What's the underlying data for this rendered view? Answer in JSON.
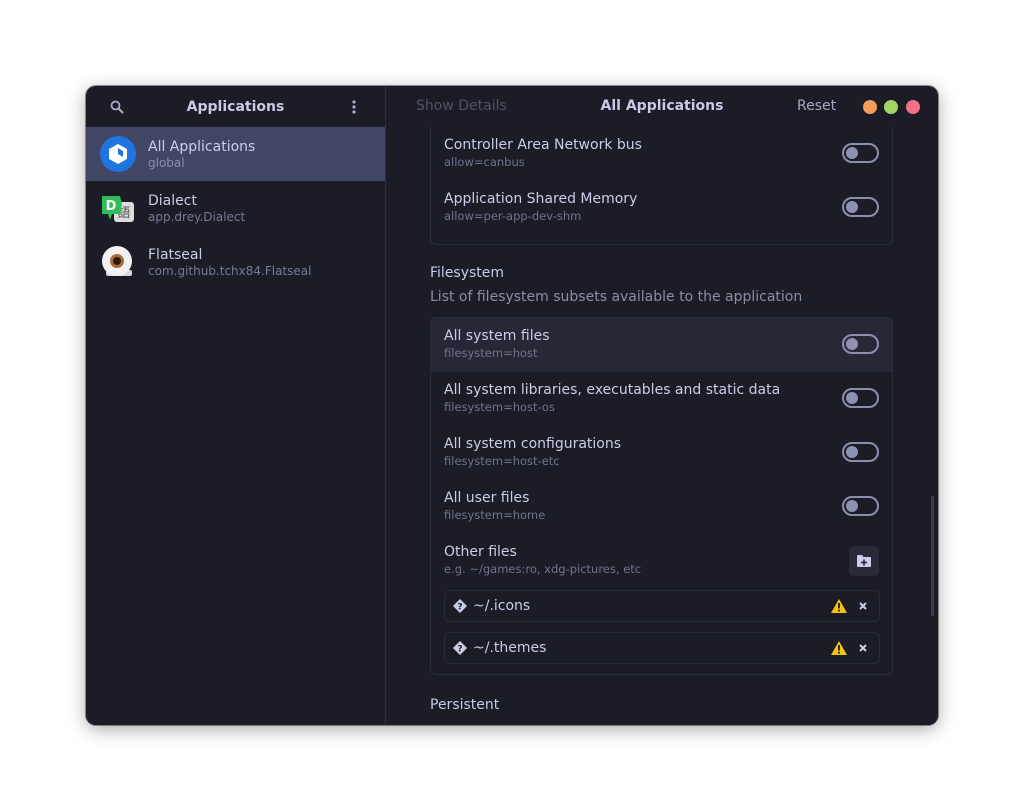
{
  "sidebar": {
    "title": "Applications",
    "search_icon": "search-icon",
    "menu_icon": "kebab-menu-icon",
    "apps": [
      {
        "name": "All Applications",
        "id": "global",
        "icon": "flatpak-cube-icon",
        "selected": true
      },
      {
        "name": "Dialect",
        "id": "app.drey.Dialect",
        "icon": "dialect-icon",
        "selected": false
      },
      {
        "name": "Flatseal",
        "id": "com.github.tchx84.Flatseal",
        "icon": "flatseal-icon",
        "selected": false
      }
    ]
  },
  "header": {
    "show_details": "Show Details",
    "title": "All Applications",
    "reset": "Reset",
    "window_controls": {
      "minimize_color": "#f59e5c",
      "maximize_color": "#a4d461",
      "close_color": "#f27089"
    }
  },
  "devices": {
    "rows": [
      {
        "label": "Controller Area Network bus",
        "sub": "allow=canbus",
        "enabled": false
      },
      {
        "label": "Application Shared Memory",
        "sub": "allow=per-app-dev-shm",
        "enabled": false
      }
    ]
  },
  "filesystem": {
    "title": "Filesystem",
    "description": "List of filesystem subsets available to the application",
    "rows": [
      {
        "label": "All system files",
        "sub": "filesystem=host",
        "enabled": false
      },
      {
        "label": "All system libraries, executables and static data",
        "sub": "filesystem=host-os",
        "enabled": false
      },
      {
        "label": "All system configurations",
        "sub": "filesystem=host-etc",
        "enabled": false
      },
      {
        "label": "All user files",
        "sub": "filesystem=home",
        "enabled": false
      }
    ],
    "other_files": {
      "label": "Other files",
      "sub": "e.g. ~/games:ro, xdg-pictures, etc",
      "add_icon": "folder-add-icon",
      "entries": [
        {
          "value": "~/.icons",
          "status_icon": "warning-icon"
        },
        {
          "value": "~/.themes",
          "status_icon": "warning-icon"
        }
      ]
    }
  },
  "persistent": {
    "title": "Persistent"
  },
  "colors": {
    "background": "#1b1c26",
    "selected": "#414664",
    "warning": "#f5c211"
  }
}
